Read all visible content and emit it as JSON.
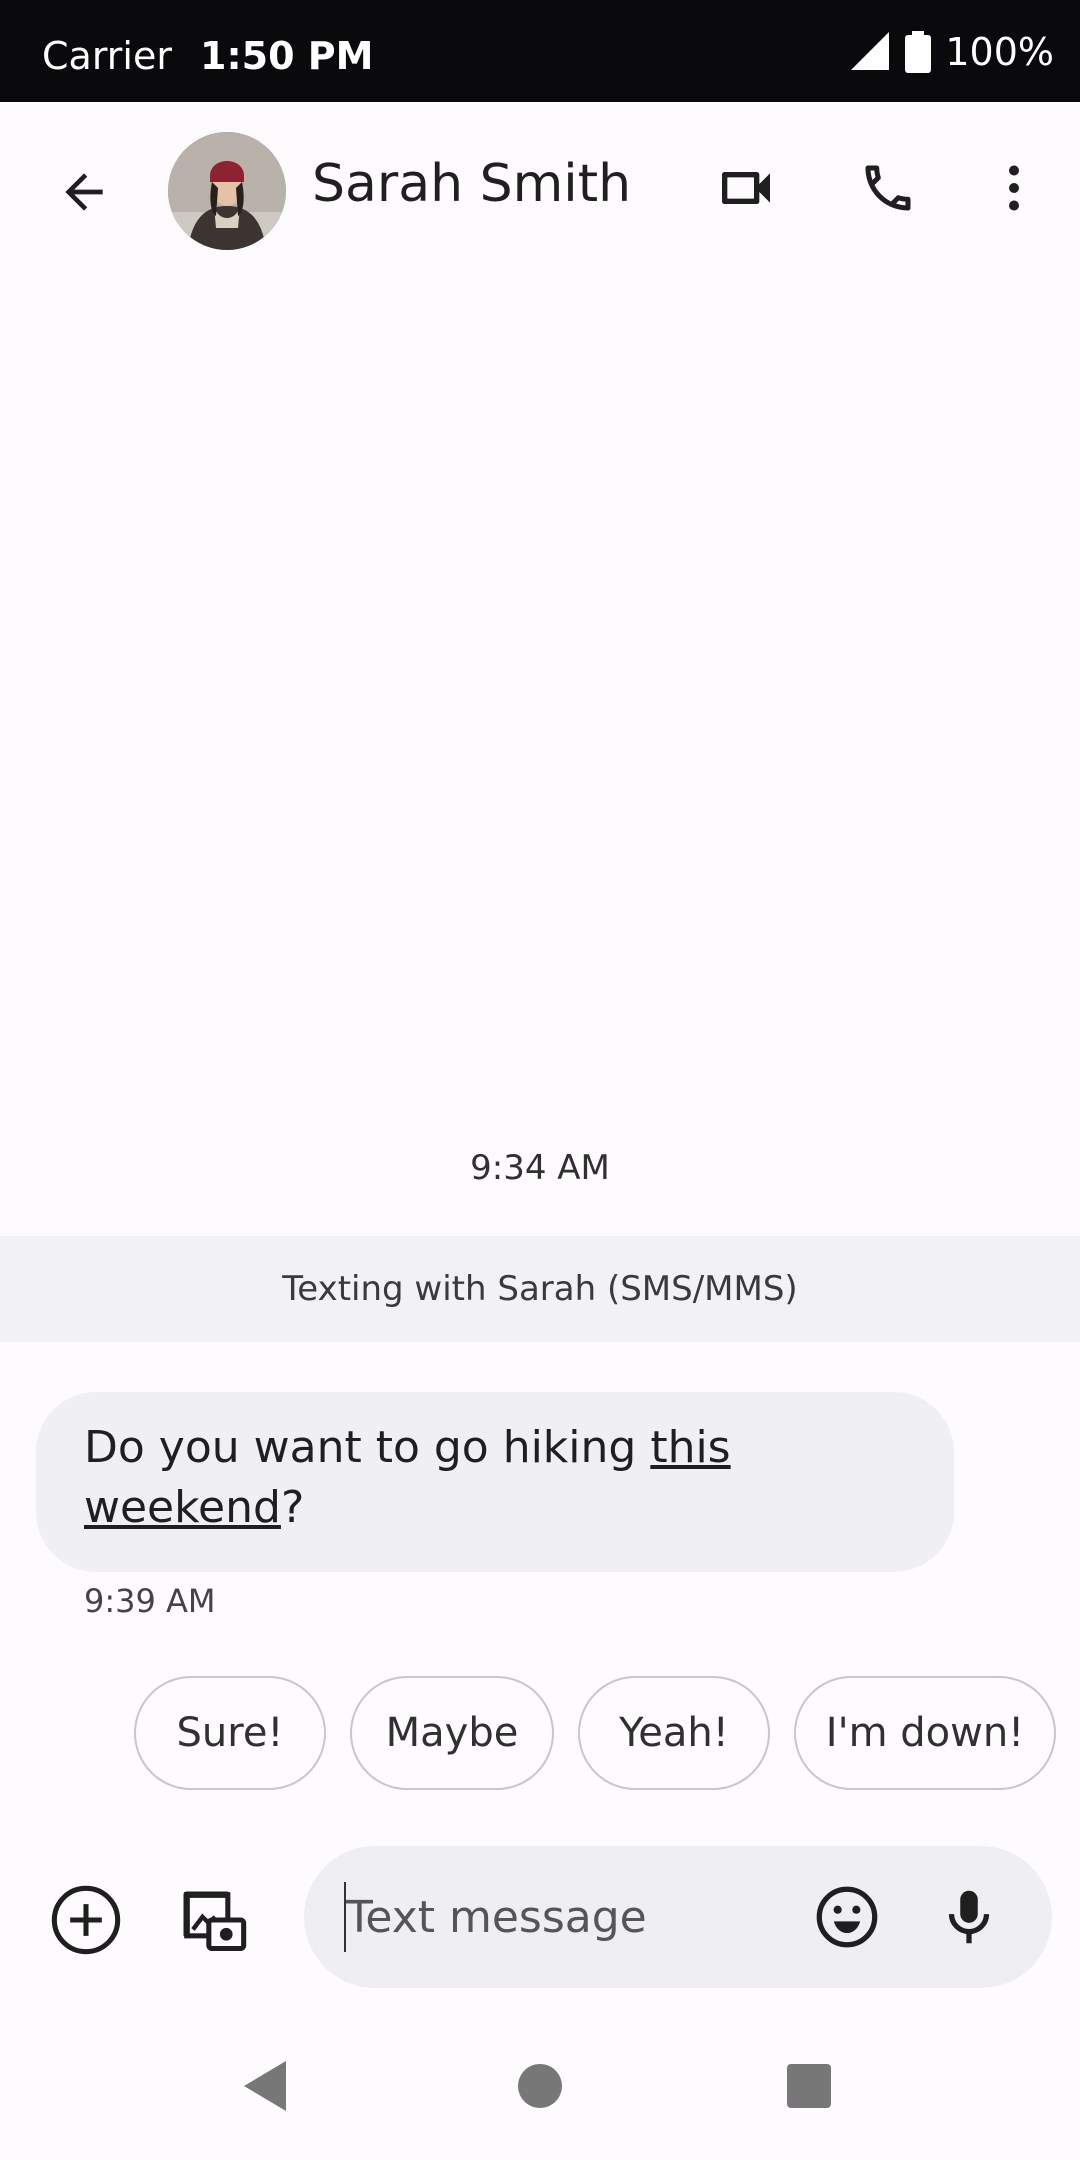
{
  "status_bar": {
    "carrier": "Carrier",
    "time": "1:50 PM",
    "battery": "100%"
  },
  "header": {
    "contact_name": "Sarah Smith",
    "back_icon": "arrow-back-icon",
    "video_icon": "videocam-icon",
    "call_icon": "phone-icon",
    "more_icon": "more-vert-icon"
  },
  "conversation": {
    "date_stamp": "9:34 AM",
    "info_banner": "Texting with Sarah (SMS/MMS)",
    "messages": [
      {
        "text_before": "Do you want to go hiking ",
        "link_text_1": "this",
        "link_text_2": "weekend",
        "text_after": "?",
        "time": "9:39 AM"
      }
    ]
  },
  "smart_replies": [
    "Sure!",
    "Maybe",
    "Yeah!",
    "I'm down!"
  ],
  "composer": {
    "placeholder": "Text message",
    "add_icon": "add-circle-icon",
    "gallery_icon": "gallery-camera-icon",
    "emoji_icon": "emoji-icon",
    "mic_icon": "mic-icon"
  },
  "nav": {
    "back": "triangle-back-icon",
    "home": "circle-home-icon",
    "recents": "square-recents-icon"
  },
  "colors": {
    "background": "#fdfbfd",
    "bubble": "#f0eff3",
    "status_bar": "#0a090b"
  }
}
